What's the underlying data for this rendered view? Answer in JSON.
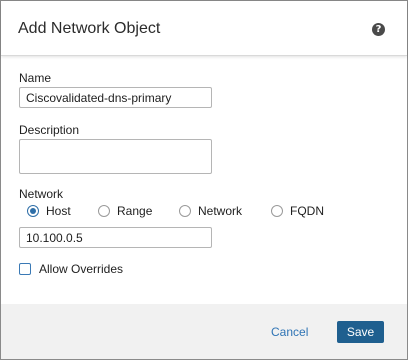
{
  "dialog": {
    "title": "Add Network Object",
    "help_icon": "help-circle-icon",
    "help_glyph": "?"
  },
  "form": {
    "name_label": "Name",
    "name_value": "Ciscovalidated-dns-primary",
    "description_label": "Description",
    "description_value": "",
    "network_label": "Network",
    "network_types": [
      {
        "label": "Host",
        "selected": true
      },
      {
        "label": "Range",
        "selected": false
      },
      {
        "label": "Network",
        "selected": false
      },
      {
        "label": "FQDN",
        "selected": false
      }
    ],
    "network_value": "10.100.0.5",
    "allow_overrides_label": "Allow Overrides",
    "allow_overrides_checked": false
  },
  "footer": {
    "cancel_label": "Cancel",
    "save_label": "Save"
  },
  "colors": {
    "accent": "#2f6fa8",
    "save_button": "#1f5f8f",
    "footer_bg": "#f1f1f1"
  }
}
